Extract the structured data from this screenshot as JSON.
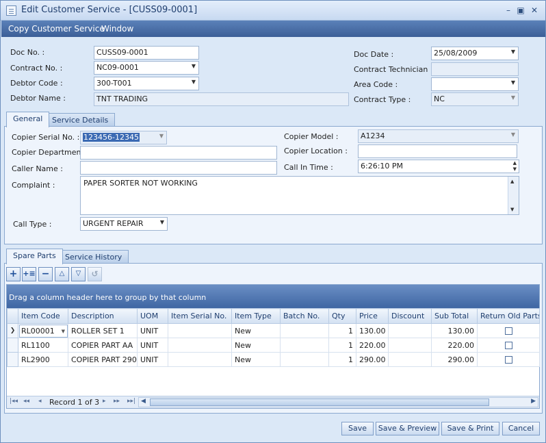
{
  "window": {
    "title": "Edit Customer Service - [CUSS09-0001]",
    "min_label": "–",
    "max_label": "▣",
    "close_label": "✕"
  },
  "menu": [
    "Copy Customer Service",
    "Window"
  ],
  "header": {
    "doc_no": {
      "label": "Doc No. :",
      "value": "CUSS09-0001"
    },
    "contract_no": {
      "label": "Contract No. :",
      "value": "NC09-0001"
    },
    "debtor_code": {
      "label": "Debtor Code :",
      "value": "300-T001"
    },
    "debtor_name": {
      "label": "Debtor Name :",
      "value": "TNT TRADING"
    },
    "doc_date": {
      "label": "Doc Date :",
      "value": "25/08/2009"
    },
    "contract_technician": {
      "label": "Contract Technician :",
      "value": ""
    },
    "area_code": {
      "label": "Area Code :",
      "value": ""
    },
    "contract_type": {
      "label": "Contract Type :",
      "value": "NC"
    }
  },
  "tabs_top": [
    "General",
    "Service Details"
  ],
  "general": {
    "copier_serial": {
      "label": "Copier Serial No. :",
      "value": "123456-12345"
    },
    "copier_department": {
      "label": "Copier Department :",
      "value": ""
    },
    "caller_name": {
      "label": "Caller Name :",
      "value": ""
    },
    "complaint": {
      "label": "Complaint :",
      "value": "PAPER SORTER NOT WORKING"
    },
    "call_type": {
      "label": "Call Type :",
      "value": "URGENT REPAIR"
    },
    "copier_model": {
      "label": "Copier Model :",
      "value": "A1234"
    },
    "copier_location": {
      "label": "Copier Location :",
      "value": ""
    },
    "call_in_time": {
      "label": "Call In Time :",
      "value": "6:26:10 PM"
    }
  },
  "tabs_bottom": [
    "Spare Parts",
    "Service History"
  ],
  "toolbar_icons": [
    "add-row-icon",
    "insert-row-icon",
    "delete-row-icon",
    "move-up-icon",
    "move-down-icon",
    "undo-icon"
  ],
  "grid": {
    "group_hint": "Drag a column header here to group by that column",
    "columns": [
      "Item Code",
      "Description",
      "UOM",
      "Item Serial No.",
      "Item Type",
      "Batch No.",
      "Qty",
      "Price",
      "Discount",
      "Sub Total",
      "Return Old Parts"
    ],
    "rows": [
      {
        "item_code": "RL00001",
        "description": "ROLLER SET 1",
        "uom": "UNIT",
        "serial": "",
        "type": "New",
        "batch": "",
        "qty": "1",
        "price": "130.00",
        "discount": "",
        "subtotal": "130.00",
        "return_old": false
      },
      {
        "item_code": "RL1100",
        "description": "COPIER PART AA",
        "uom": "UNIT",
        "serial": "",
        "type": "New",
        "batch": "",
        "qty": "1",
        "price": "220.00",
        "discount": "",
        "subtotal": "220.00",
        "return_old": false
      },
      {
        "item_code": "RL2900",
        "description": "COPIER PART 2900",
        "uom": "UNIT",
        "serial": "",
        "type": "New",
        "batch": "",
        "qty": "1",
        "price": "290.00",
        "discount": "",
        "subtotal": "290.00",
        "return_old": false
      }
    ],
    "record_text": "Record 1 of 3"
  },
  "buttons": {
    "save": "Save",
    "save_preview": "Save & Preview",
    "save_print": "Save & Print",
    "cancel": "Cancel"
  }
}
